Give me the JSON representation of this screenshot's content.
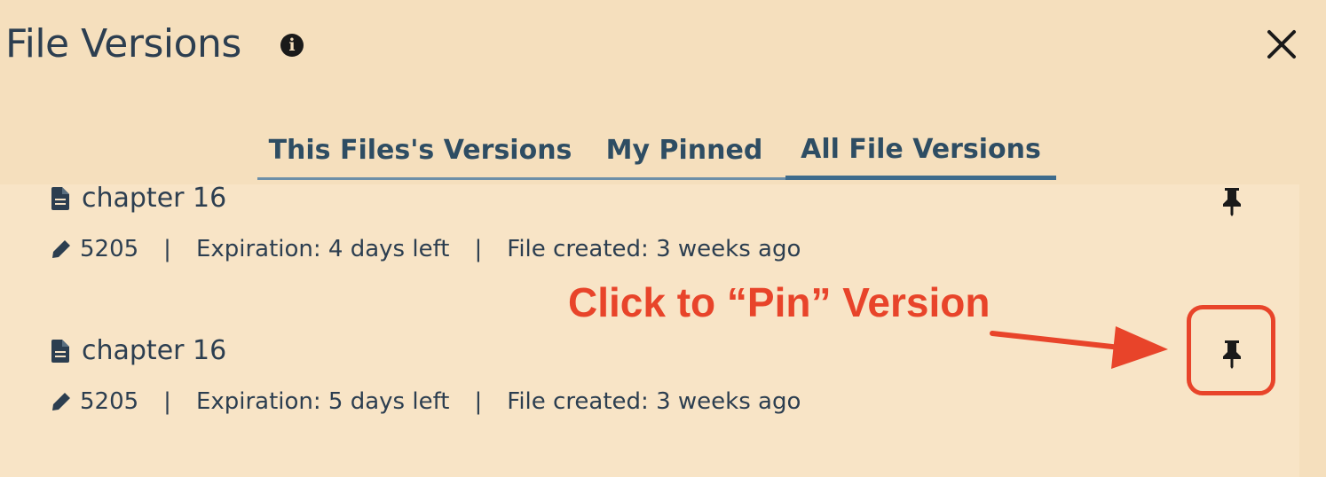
{
  "dialog": {
    "title": "File Versions",
    "info_icon": "info-circle-icon",
    "close_icon": "close-icon"
  },
  "tabs": [
    {
      "label": "This Files's Versions",
      "active": false
    },
    {
      "label": "My Pinned",
      "active": false
    },
    {
      "label": "All File Versions",
      "active": true
    }
  ],
  "versions": [
    {
      "name": "chapter 16",
      "file_icon": "file-text-icon",
      "edit_icon": "pencil-icon",
      "id": "5205",
      "expiration": "Expiration: 4 days left",
      "created": "File created: 3 weeks ago",
      "pin_icon": "thumbtack-icon"
    },
    {
      "name": "chapter 16",
      "file_icon": "file-text-icon",
      "edit_icon": "pencil-icon",
      "id": "5205",
      "expiration": "Expiration: 5 days left",
      "created": "File created: 3 weeks ago",
      "pin_icon": "thumbtack-icon"
    }
  ],
  "separator": "|",
  "annotation": {
    "text": "Click to “Pin” Version",
    "color": "#e8442a"
  },
  "colors": {
    "background": "#f5dfbd",
    "text": "#2c3e50",
    "tab_active_underline": "#3d6b8c"
  }
}
